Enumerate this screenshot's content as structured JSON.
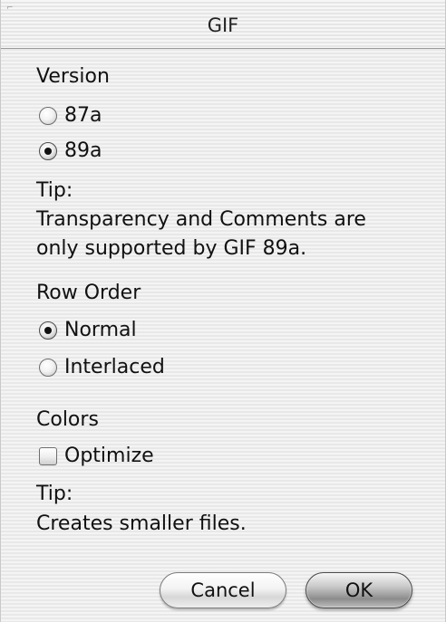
{
  "window": {
    "title": "GIF"
  },
  "version": {
    "heading": "Version",
    "options": [
      {
        "label": "87a",
        "selected": false
      },
      {
        "label": "89a",
        "selected": true
      }
    ],
    "tip_heading": "Tip:",
    "tip_lines": [
      "Transparency and Comments are",
      "only supported by GIF 89a."
    ]
  },
  "row_order": {
    "heading": "Row Order",
    "options": [
      {
        "label": "Normal",
        "selected": true
      },
      {
        "label": "Interlaced",
        "selected": false
      }
    ]
  },
  "colors": {
    "heading": "Colors",
    "optimize": {
      "label": "Optimize",
      "checked": false
    },
    "tip_heading": "Tip:",
    "tip_text": "Creates smaller files."
  },
  "buttons": {
    "cancel": "Cancel",
    "ok": "OK"
  }
}
